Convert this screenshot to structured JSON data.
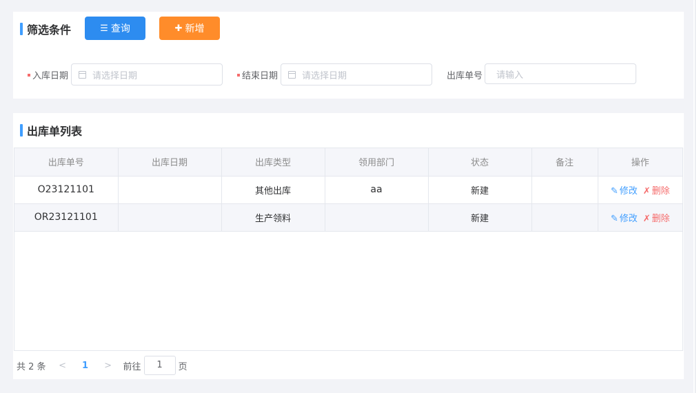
{
  "filter": {
    "title": "筛选条件",
    "query_label": "查询",
    "add_label": "新增",
    "start_date_label": "入库日期",
    "end_date_label": "结束日期",
    "order_no_label": "出库单号",
    "start_date_placeholder": "请选择日期",
    "end_date_placeholder": "请选择日期",
    "order_no_placeholder": "请输入"
  },
  "list": {
    "title": "出库单列表",
    "columns": [
      "出库单号",
      "出库日期",
      "出库类型",
      "领用部门",
      "状态",
      "备注",
      "操作"
    ],
    "rows": [
      {
        "order_no": "O23121101",
        "date": "",
        "type": "其他出库",
        "dept": "aa",
        "status": "新建",
        "remark": ""
      },
      {
        "order_no": "OR23121101",
        "date": "",
        "type": "生产领料",
        "dept": "",
        "status": "新建",
        "remark": ""
      }
    ],
    "edit_label": "修改",
    "delete_label": "删除"
  },
  "pager": {
    "total": "共 2 条",
    "current_page": "1",
    "goto_label": "前往",
    "goto_value": "1",
    "unit": "页"
  },
  "icons": {
    "query": "list-icon",
    "add": "plus-icon",
    "calendar": "calendar-icon",
    "edit": "pencil-icon",
    "delete": "x-mark-icon",
    "prev": "chevron-left-icon",
    "next": "chevron-right-icon"
  },
  "colors": {
    "primary": "#2d8cf0",
    "warning": "#ff8c2a",
    "danger": "#f56c6c",
    "accent": "#409eff"
  }
}
